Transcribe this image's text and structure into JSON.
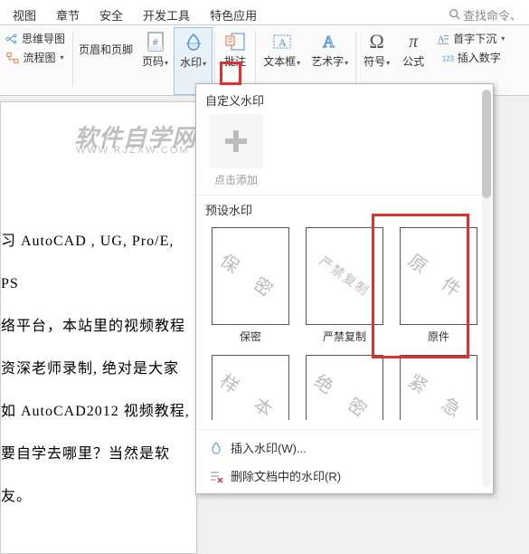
{
  "tabs": [
    "视图",
    "章节",
    "安全",
    "开发工具",
    "特色应用"
  ],
  "search_placeholder": "查找命令、",
  "ribbon": {
    "mind_map": "思维导图",
    "flowchart": "流程图",
    "header_footer": "页眉和页脚",
    "page_number": "页码",
    "watermark": "水印",
    "comment": "批注",
    "textbox": "文本框",
    "wordart": "艺术字",
    "symbol": "符号",
    "formula": "公式",
    "dropcap": "首字下沉",
    "insert_number": "插入数字"
  },
  "dropdown": {
    "custom_title": "自定义水印",
    "add_label": "点击添加",
    "preset_title": "预设水印",
    "presets_row1": [
      {
        "wm": "保 密",
        "label": "保密"
      },
      {
        "wm": "严禁复制",
        "label": "严禁复制"
      },
      {
        "wm": "原 件",
        "label": "原件"
      }
    ],
    "presets_row2": [
      {
        "wm": "样 本"
      },
      {
        "wm": "绝 密"
      },
      {
        "wm": "紧 急"
      }
    ],
    "insert_wm": "插入水印(W)...",
    "remove_wm": "删除文档中的水印(R)"
  },
  "doc_lines": [
    "习 AutoCAD , UG, Pro/E, PS",
    "络平台，本站里的视频教程",
    "资深老师录制, 绝对是大家",
    "如 AutoCAD2012 视频教程,",
    "要自学去哪里？当然是软",
    "友。"
  ],
  "watermark_logo": "软件自学网",
  "watermark_url": "WWW.RJZXW.COM"
}
